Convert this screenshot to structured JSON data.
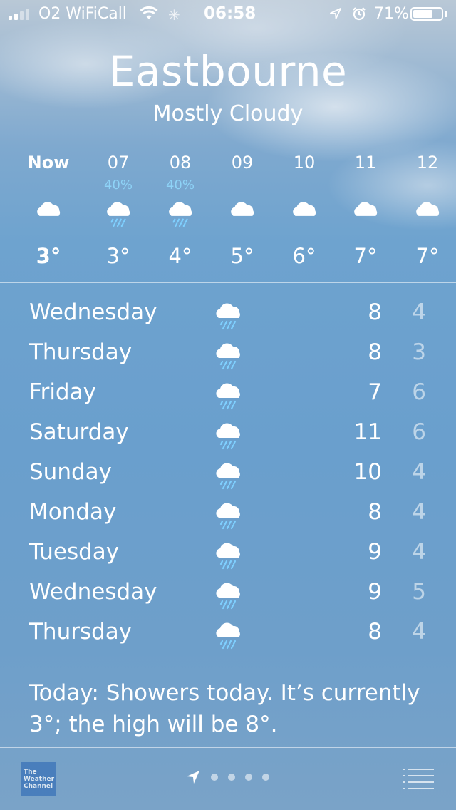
{
  "status_bar": {
    "carrier": "O2 WiFiCall",
    "time": "06:58",
    "battery_percent": "71%",
    "battery_level": 0.71,
    "signal_bars_active": 2,
    "signal_bars_total": 4,
    "icons": [
      "signal-icon",
      "wifi-icon",
      "activity-spinner-icon",
      "location-arrow-icon",
      "alarm-icon",
      "battery-icon"
    ]
  },
  "location": {
    "city": "Eastbourne",
    "condition": "Mostly Cloudy"
  },
  "hourly": [
    {
      "time": "Now",
      "pop": "",
      "icon": "cloud-icon",
      "temp": "3°"
    },
    {
      "time": "07",
      "pop": "40%",
      "icon": "rain-cloud-icon",
      "temp": "3°"
    },
    {
      "time": "08",
      "pop": "40%",
      "icon": "rain-cloud-icon",
      "temp": "4°"
    },
    {
      "time": "09",
      "pop": "",
      "icon": "cloud-icon",
      "temp": "5°"
    },
    {
      "time": "10",
      "pop": "",
      "icon": "cloud-icon",
      "temp": "6°"
    },
    {
      "time": "11",
      "pop": "",
      "icon": "cloud-icon",
      "temp": "7°"
    },
    {
      "time": "12",
      "pop": "",
      "icon": "cloud-icon",
      "temp": "7°"
    }
  ],
  "daily": [
    {
      "day": "Wednesday",
      "icon": "rain-cloud-icon",
      "high": "8",
      "low": "4"
    },
    {
      "day": "Thursday",
      "icon": "rain-cloud-icon",
      "high": "8",
      "low": "3"
    },
    {
      "day": "Friday",
      "icon": "rain-cloud-icon",
      "high": "7",
      "low": "6"
    },
    {
      "day": "Saturday",
      "icon": "rain-cloud-icon",
      "high": "11",
      "low": "6"
    },
    {
      "day": "Sunday",
      "icon": "rain-cloud-icon",
      "high": "10",
      "low": "4"
    },
    {
      "day": "Monday",
      "icon": "rain-cloud-icon",
      "high": "8",
      "low": "4"
    },
    {
      "day": "Tuesday",
      "icon": "rain-cloud-icon",
      "high": "9",
      "low": "4"
    },
    {
      "day": "Wednesday",
      "icon": "rain-cloud-icon",
      "high": "9",
      "low": "5"
    },
    {
      "day": "Thursday",
      "icon": "rain-cloud-icon",
      "high": "8",
      "low": "4"
    }
  ],
  "summary": "Today: Showers today. It’s currently 3°; the high will be 8°.",
  "bottom_bar": {
    "logo_text": [
      "The",
      "Weather",
      "Channel"
    ],
    "page_dots": 4,
    "icons": [
      "weather-channel-logo",
      "location-arrow-icon",
      "list-icon"
    ]
  },
  "colors": {
    "pop_text": "#8ed3f7",
    "low_temp_text": "rgba(255,255,255,0.55)",
    "sky_top": "#b9c8d6",
    "sky_main": "#6a9fcd"
  }
}
